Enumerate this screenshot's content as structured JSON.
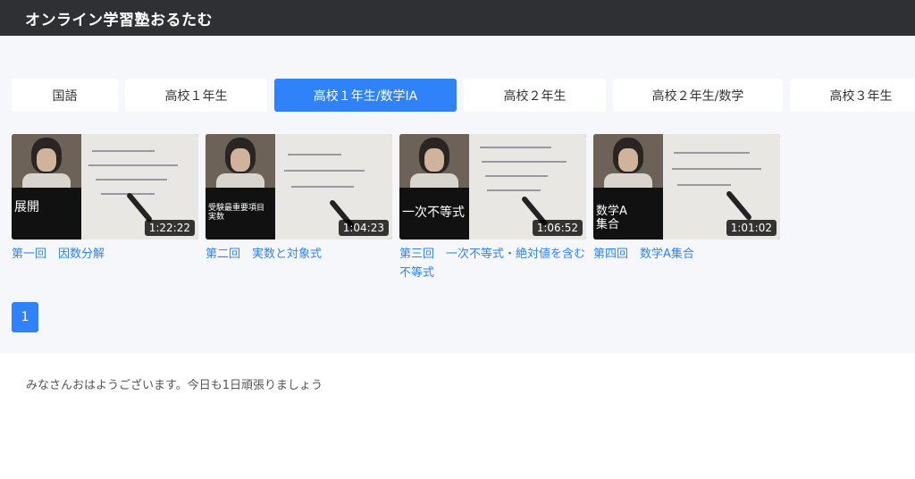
{
  "header": {
    "site_title": "オンライン学習塾おるたむ"
  },
  "tabs": [
    {
      "label": "国語",
      "active": false
    },
    {
      "label": "高校１年生",
      "active": false
    },
    {
      "label": "高校１年生/数学IA",
      "active": true
    },
    {
      "label": "高校２年生",
      "active": false
    },
    {
      "label": "高校２年生/数学",
      "active": false
    },
    {
      "label": "高校３年生",
      "active": false
    }
  ],
  "videos": [
    {
      "caption": "展開",
      "duration": "1:22:22",
      "title": "第一回　因数分解"
    },
    {
      "caption": "受験最重要項目\n実数",
      "duration": "1:04:23",
      "title": "第二回　実数と対象式"
    },
    {
      "caption": "一次不等式",
      "duration": "1:06:52",
      "title": "第三回　一次不等式・絶対値を含む不等式"
    },
    {
      "caption": "数学A\n集合",
      "duration": "1:01:02",
      "title": "第四回　数学A集合"
    }
  ],
  "pagination": {
    "current_page": "1"
  },
  "footer": {
    "greeting": "みなさんおはようございます。今日も1日頑張りましょう"
  },
  "colors": {
    "accent": "#2f82f7",
    "header_bg": "#2e3033",
    "main_bg": "#f5f7fa"
  }
}
